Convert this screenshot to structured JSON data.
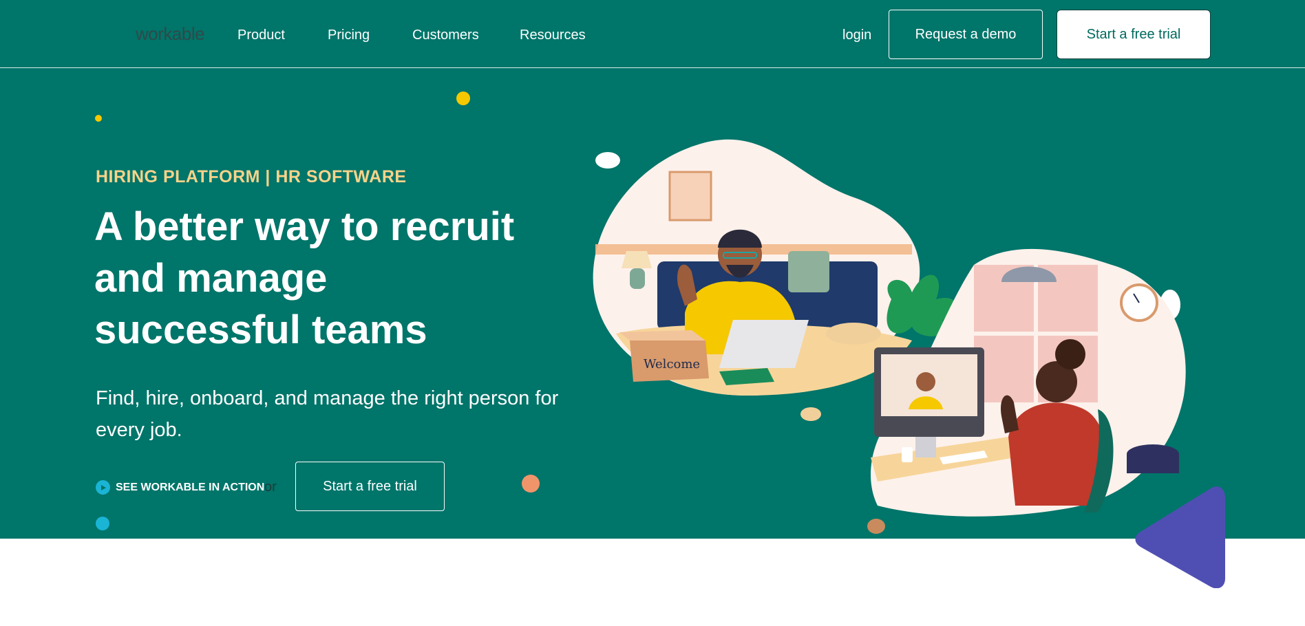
{
  "nav": {
    "logo": "workable",
    "links": [
      "Product",
      "Pricing",
      "Customers",
      "Resources"
    ],
    "login": "login",
    "request_demo": "Request a demo",
    "start_trial": "Start a free trial"
  },
  "hero": {
    "eyebrow": "HIRING PLATFORM | HR SOFTWARE",
    "headline": "A better way to recruit and manage successful teams",
    "subhead": "Find, hire, onboard, and manage the right person for every job.",
    "see_action": "SEE WORKABLE IN ACTION",
    "or": "or",
    "start_trial": "Start a free trial",
    "illustration_text": "Welcome"
  },
  "colors": {
    "brand_green": "#00756a",
    "eyebrow_gold": "#f7d38a",
    "play_blue": "#1ab4d4",
    "accent_purple": "#4f4fb3",
    "dot_yellow": "#f5c800",
    "dot_orange": "#f0956a"
  },
  "icons": {
    "play": "play-icon"
  }
}
